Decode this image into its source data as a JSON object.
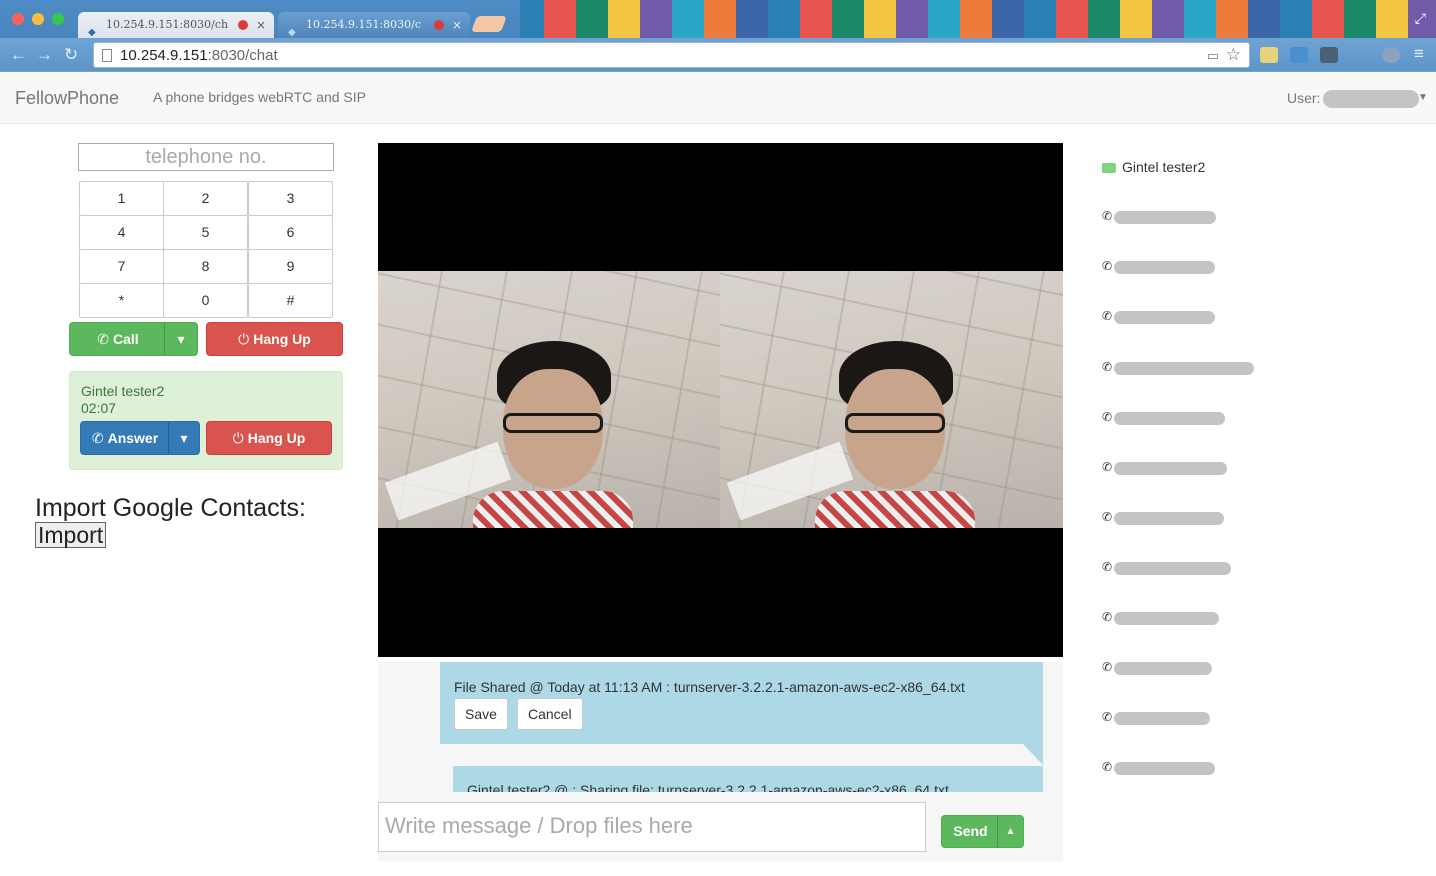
{
  "browser": {
    "tabs": [
      {
        "label": "10.254.9.151:8030/ch",
        "active": true
      },
      {
        "label": "10.254.9.151:8030/c",
        "active": false
      }
    ],
    "url_host": "10.254.9.151",
    "url_path": ":8030/chat"
  },
  "navbar": {
    "brand": "FellowPhone",
    "tagline": "A phone bridges webRTC and SIP",
    "user_label": "User:"
  },
  "dialer": {
    "placeholder": "telephone no.",
    "keys": [
      "1",
      "2",
      "3",
      "4",
      "5",
      "6",
      "7",
      "8",
      "9",
      "*",
      "0",
      "#"
    ],
    "call_label": "Call",
    "hangup_label": "Hang Up"
  },
  "incoming_call": {
    "caller": "Gintel tester2",
    "duration": "02:07",
    "answer_label": "Answer",
    "hangup_label": "Hang Up"
  },
  "import": {
    "title": "Import Google Contacts:",
    "button_label": "Import"
  },
  "chat": {
    "messages": [
      {
        "text": "File Shared @ Today at 11:13 AM : turnserver-3.2.2.1-amazon-aws-ec2-x86_64.txt"
      },
      {
        "text": "Gintel tester2 @ : Sharing file: turnserver-3.2.2.1-amazon-aws-ec2-x86_64.txt"
      }
    ],
    "save_label": "Save",
    "cancel_label": "Cancel",
    "input_placeholder": "Write message / Drop files here",
    "send_label": "Send"
  },
  "contacts": {
    "online": {
      "name": "Gintel tester2",
      "icon": "video-camera-icon"
    },
    "others_count_visible": 12
  },
  "colors": {
    "success": "#5cb85c",
    "danger": "#d9534f",
    "primary": "#337ab7",
    "message_bg": "#add8e6",
    "alert_success_bg": "#dff0d8"
  }
}
